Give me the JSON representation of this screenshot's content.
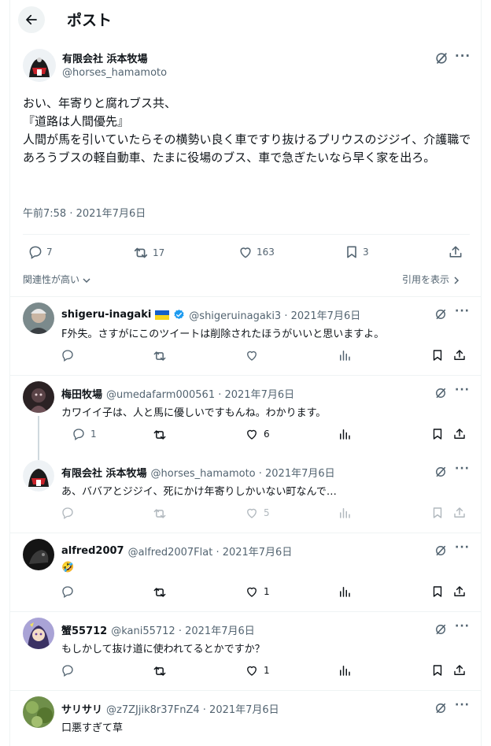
{
  "header": {
    "title": "ポスト"
  },
  "main_post": {
    "name": "有限会社 浜本牧場",
    "handle": "@horses_hamamoto",
    "text": "おい、年寄りと腐れブス共、\n『道路は人間優先』\n人間が馬を引いていたらその横勢い良く車ですり抜けるプリウスのジジイ、介護職であろうブスの軽自動車、たまに役場のブス、車で急ぎたいなら早く家を出ろ。",
    "time": "午前7:58 · 2021年7月6日",
    "stats": {
      "replies": "7",
      "reposts": "17",
      "likes": "163",
      "bookmarks": "3"
    }
  },
  "sort_label": "関連性が高い",
  "quotes_label": "引用を表示",
  "replies": [
    {
      "name": "shigeru-inagaki",
      "flag": "🇺🇦",
      "verified": true,
      "meta": "@shigeruinagaki3 · 2021年7月6日",
      "text": "F外失。さすがにこのツイートは削除されたほうがいいと思いますよ。",
      "replies": "",
      "reposts": "",
      "likes": ""
    },
    {
      "name": "梅田牧場",
      "meta": "@umedafarm000561 · 2021年7月6日",
      "text": "カワイイ子は、人と馬に優しいですもんね。わかります。",
      "replies": "1",
      "reposts": "",
      "likes": "6"
    },
    {
      "name": "有限会社 浜本牧場",
      "meta": "@horses_hamamoto · 2021年7月6日",
      "text": "あ、ババアとジジイ、死にかけ年寄りしかいない町なんで…",
      "replies": "",
      "reposts": "",
      "likes": "5"
    },
    {
      "name": "alfred2007",
      "meta": "@alfred2007Flat · 2021年7月6日",
      "text": "🤣",
      "replies": "",
      "reposts": "",
      "likes": "1"
    },
    {
      "name": "蟹55712",
      "meta": "@kani55712 · 2021年7月6日",
      "text": "もしかして抜け道に使われてるとかですか？",
      "replies": "",
      "reposts": "",
      "likes": "1"
    },
    {
      "name": "サリサリ",
      "meta": "@z7ZJjik8r37FnZ4 · 2021年7月6日",
      "text": "口悪すぎて草",
      "replies": "",
      "reposts": "",
      "likes": ""
    }
  ],
  "colors": {
    "text": "#0f1419",
    "secondary": "#536471",
    "border": "#eff3f4",
    "verified": "#1d9bf0"
  },
  "icons": [
    "back-arrow-icon",
    "grok-icon",
    "more-icon",
    "reply-icon",
    "repost-icon",
    "like-icon",
    "views-icon",
    "bookmark-icon",
    "share-icon",
    "verified-icon",
    "chevron-down-icon",
    "chevron-right-icon"
  ]
}
